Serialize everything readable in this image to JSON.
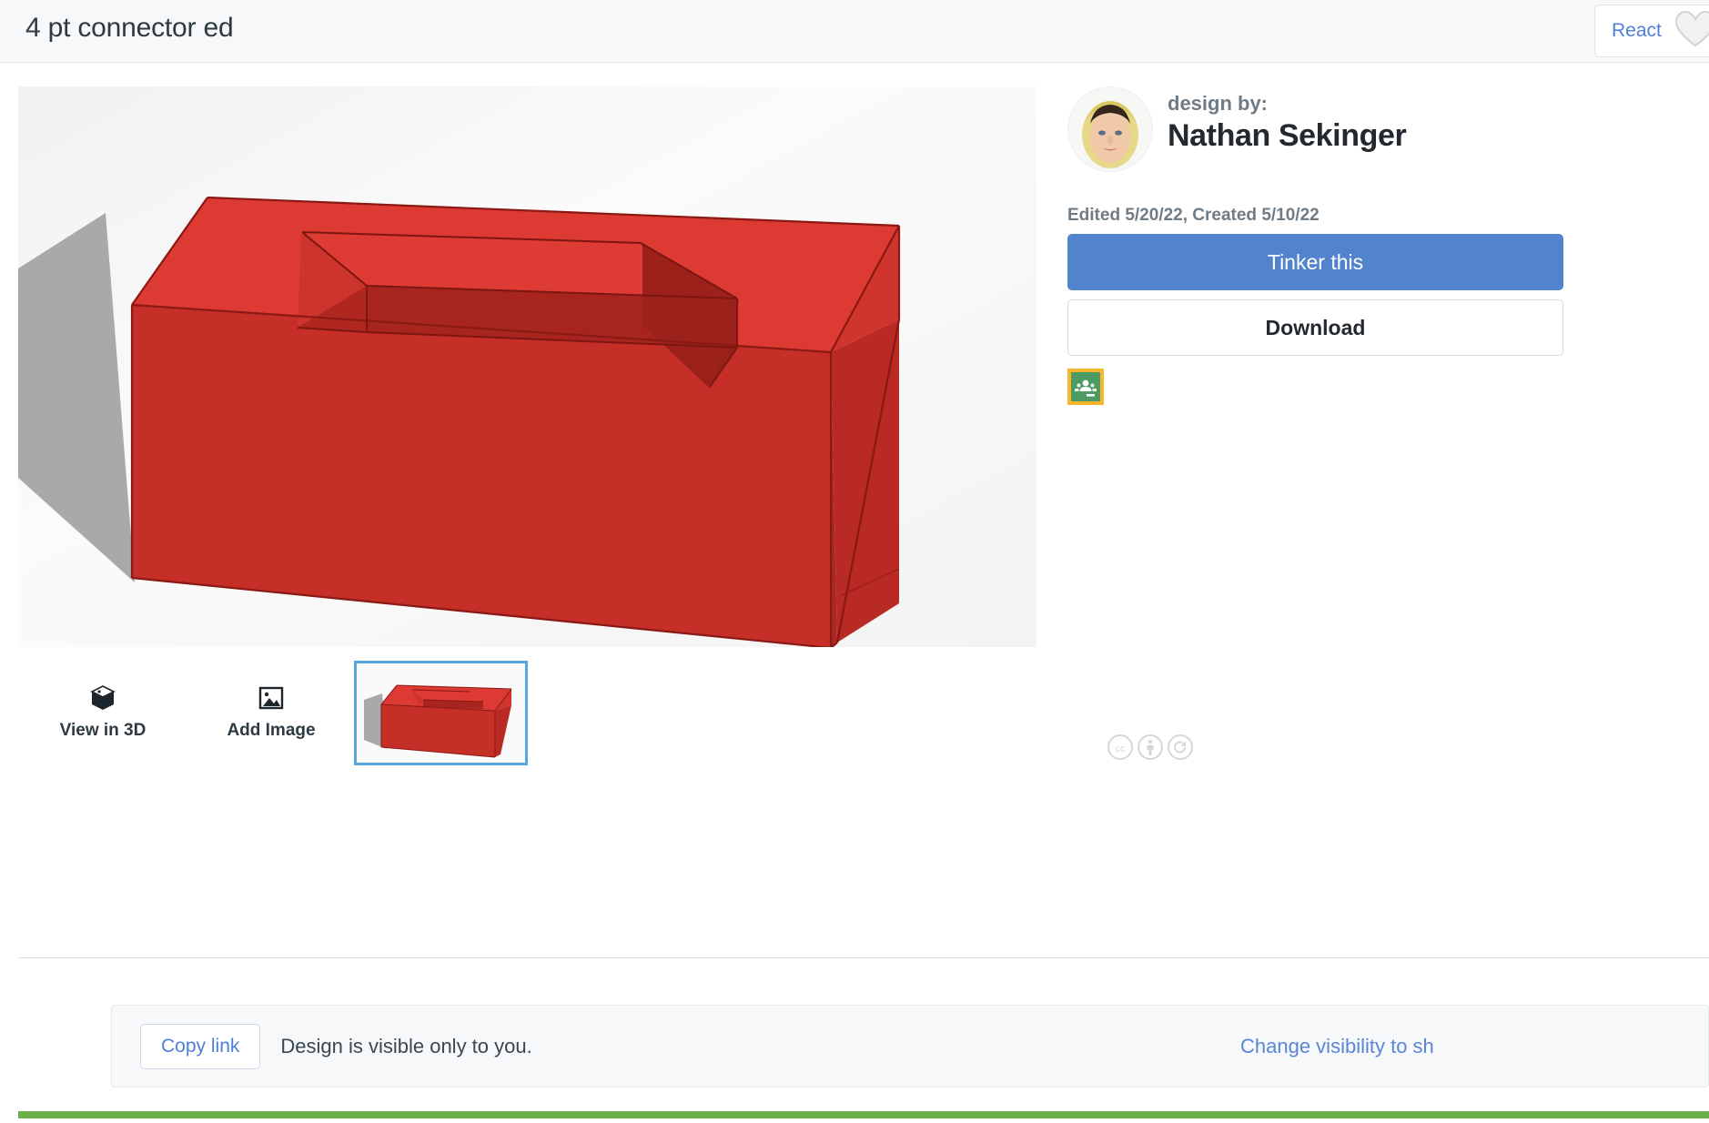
{
  "header": {
    "title": "4 pt connector ed",
    "react_label": "React",
    "heart_icon": "heart-outline-icon"
  },
  "viewer": {
    "model_name": "4-pt-connector-3d-model",
    "model_colors": {
      "top_face": "#dc3a32",
      "front_face": "#c52f28",
      "right_face": "#bd2b24",
      "cavity_inner": "#a8241e",
      "edge_line": "#8f1a15",
      "shadow": "#a8a8a8",
      "background": "#f4f4f4"
    },
    "cc_badges": [
      "cc-icon",
      "attribution-person-icon",
      "share-alike-icon"
    ]
  },
  "tools": [
    {
      "label": "View in 3D",
      "icon": "cube-icon"
    },
    {
      "label": "Add Image",
      "icon": "image-icon"
    }
  ],
  "thumbnail": {
    "name": "design-thumbnail",
    "selected": true,
    "border_color": "#56a7e0"
  },
  "sidebar": {
    "design_by_label": "design by:",
    "author_name": "Nathan Sekinger",
    "avatar_alt": "author-avatar",
    "dates": "Edited 5/20/22, Created 5/10/22",
    "tinker_label": "Tinker this",
    "tinker_color": "#5284ce",
    "download_label": "Download",
    "classroom_icon": "google-classroom-icon",
    "classroom_colors": {
      "border": "#f8b62c",
      "fill": "#4d9b63"
    }
  },
  "share_bar": {
    "copy_link_label": "Copy link",
    "visibility_text": "Design is visible only to you.",
    "change_visibility_label": "Change visibility to sh"
  },
  "footer": {
    "accent_color": "#6cb04e"
  }
}
